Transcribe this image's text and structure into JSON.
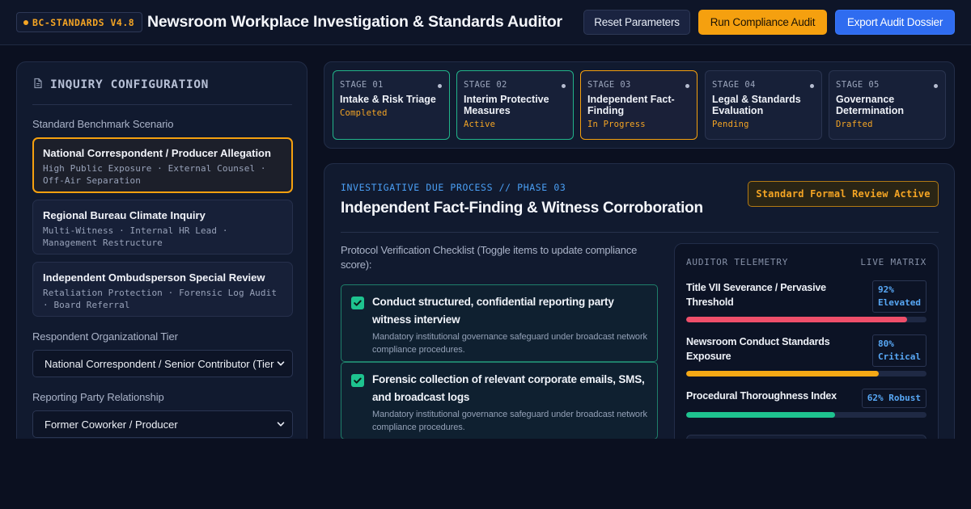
{
  "header": {
    "badge": "BC-STANDARDS V4.8",
    "title": "Newsroom Workplace Investigation & Standards Auditor",
    "buttons": {
      "reset": "Reset Parameters",
      "run": "Run Compliance Audit",
      "export": "Export Audit Dossier"
    }
  },
  "sidebar": {
    "title": "INQUIRY CONFIGURATION",
    "scenario_label": "Standard Benchmark Scenario",
    "scenarios": [
      {
        "title": "National Correspondent / Producer Allegation",
        "subtitle": "High Public Exposure · External Counsel · Off-Air Separation",
        "selected": true
      },
      {
        "title": "Regional Bureau Climate Inquiry",
        "subtitle": "Multi-Witness · Internal HR Lead · Management Restructure",
        "selected": false
      },
      {
        "title": "Independent Ombudsperson Special Review",
        "subtitle": "Retaliation Protection · Forensic Log Audit · Board Referral",
        "selected": false
      }
    ],
    "tier_label": "Respondent Organizational Tier",
    "tier_value": "National Correspondent / Senior Contributor (Tier",
    "relationship_label": "Reporting Party Relationship",
    "relationship_value": "Former Coworker / Producer"
  },
  "stages": [
    {
      "num": "STAGE 01",
      "name": "Intake & Risk Triage",
      "status": "Completed",
      "state": "done"
    },
    {
      "num": "STAGE 02",
      "name": "Interim Protective Measures",
      "status": "Active",
      "state": "active"
    },
    {
      "num": "STAGE 03",
      "name": "Independent Fact-Finding",
      "status": "In Progress",
      "state": "progress"
    },
    {
      "num": "STAGE 04",
      "name": "Legal & Standards Evaluation",
      "status": "Pending",
      "state": "pending"
    },
    {
      "num": "STAGE 05",
      "name": "Governance Determination",
      "status": "Drafted",
      "state": "pending"
    }
  ],
  "main": {
    "phase_label": "INVESTIGATIVE DUE PROCESS // PHASE 03",
    "phase_title": "Independent Fact-Finding & Witness Corroboration",
    "review_badge": "Standard Formal Review Active",
    "checklist_intro": "Protocol Verification Checklist (Toggle items to update compliance score):",
    "checklist": [
      {
        "title": "Conduct structured, confidential reporting party witness interview",
        "subtitle": "Mandatory institutional governance safeguard under broadcast network compliance procedures.",
        "checked": true
      },
      {
        "title": "Forensic collection of relevant corporate emails, SMS, and broadcast logs",
        "subtitle": "Mandatory institutional governance safeguard under broadcast network compliance procedures.",
        "checked": true
      }
    ]
  },
  "telemetry": {
    "header": "AUDITOR TELEMETRY",
    "live": "LIVE MATRIX",
    "metrics": [
      {
        "name": "Title VII Severance / Pervasive Threshold",
        "value": "92%",
        "level": "Elevated",
        "percent": 92,
        "color": "#ef4f6a"
      },
      {
        "name": "Newsroom Conduct Standards Exposure",
        "value": "80%",
        "level": "Critical",
        "percent": 80,
        "color": "#f5a815"
      },
      {
        "name": "Procedural Thoroughness Index",
        "value": "62%",
        "level": "Robust",
        "percent": 62,
        "color": "#1ec38f"
      }
    ]
  }
}
